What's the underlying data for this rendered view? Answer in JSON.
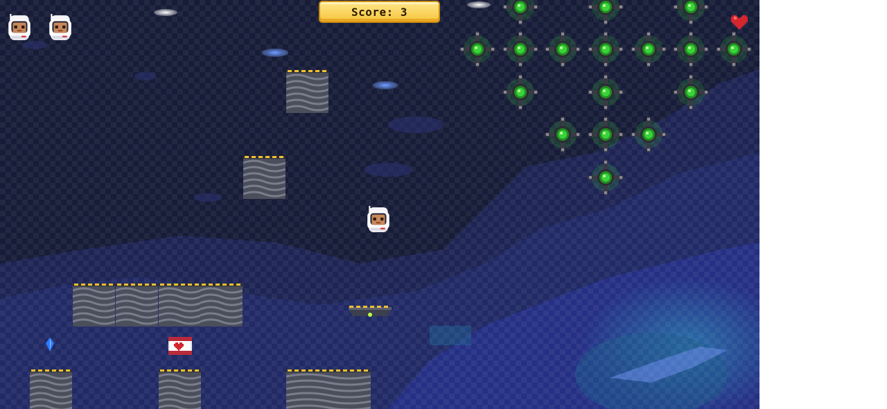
{
  "hud": {
    "score_label": "Score",
    "score_value": "3",
    "lives": 2,
    "heart_icon": "heart-icon"
  },
  "colors": {
    "sky": "#171c38",
    "nebula_blue": "#26307a",
    "nebula_teal": "#1f5a8c",
    "mine_glow": "#3bd23b",
    "hazard_yellow": "#f2c230",
    "banner_gold": "#f6c53b",
    "heart_red": "#d4262e"
  },
  "sprites": {
    "player": "astronaut-icon",
    "mine": "space-mine-icon",
    "crystal": "blue-crystal-icon",
    "health_chest": "heart-chest-icon",
    "hover_platform": "hover-platform-icon"
  }
}
